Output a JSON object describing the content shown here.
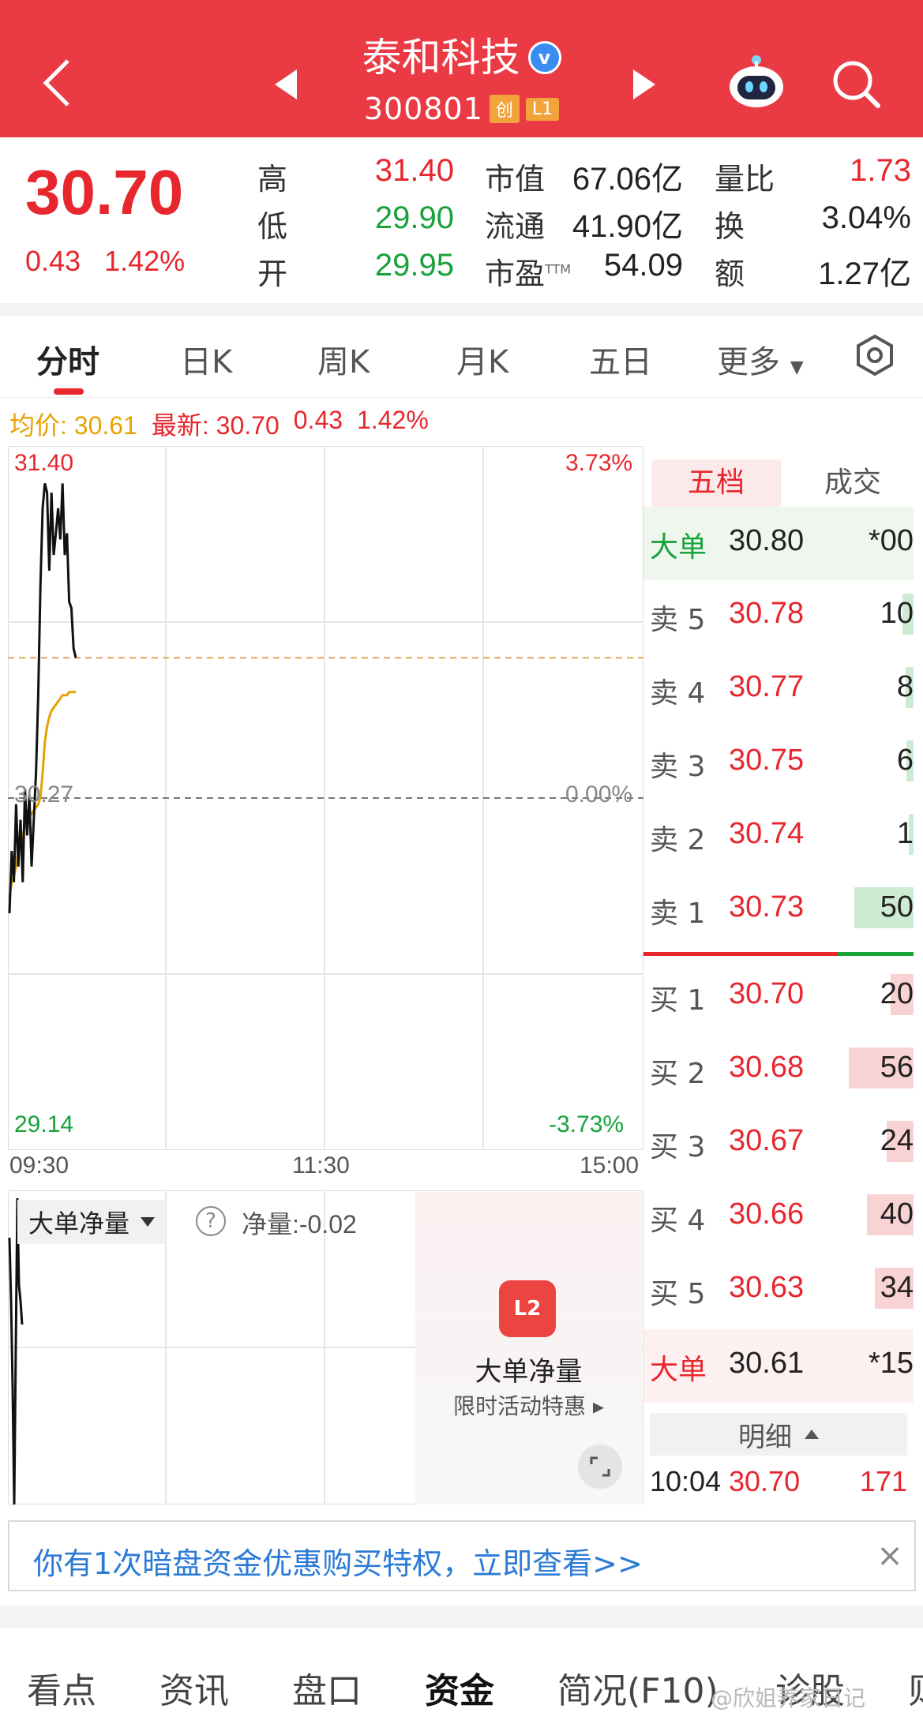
{
  "header": {
    "title": "泰和科技",
    "code": "300801",
    "tag_board": "创",
    "tag_level": "L1",
    "bg_color": "#ea3a44"
  },
  "quote": {
    "price": "30.70",
    "change": "0.43",
    "change_pct": "1.42%",
    "high_label": "高",
    "high": "31.40",
    "low_label": "低",
    "low": "29.90",
    "open_label": "开",
    "open": "29.95",
    "mcap_label": "市值",
    "mcap": "67.06亿",
    "float_label": "流通",
    "float": "41.90亿",
    "pe_label": "市盈",
    "pe_sup": "TTM",
    "pe": "54.09",
    "vol_ratio_label": "量比",
    "vol_ratio": "1.73",
    "turnover_label": "换",
    "turnover": "3.04%",
    "amount_label": "额",
    "amount": "1.27亿"
  },
  "tabs": [
    "分时",
    "日K",
    "周K",
    "月K",
    "五日",
    "更多"
  ],
  "info_line": {
    "avg": "均价: 30.61",
    "latest": "最新: 30.70",
    "change": "0.43",
    "change_pct": "1.42%"
  },
  "chart_data": {
    "type": "line",
    "y_top": "31.40",
    "y_bottom": "29.14",
    "y_mid": "30.27",
    "pct_top": "3.73%",
    "pct_mid": "0.00%",
    "pct_bottom": "-3.73%",
    "ylim": [
      29.14,
      31.4
    ],
    "x_ticks": [
      "09:30",
      "11:30",
      "15:00"
    ],
    "series": [
      {
        "name": "最新",
        "values": [
          29.9,
          30.1,
          30.0,
          30.25,
          30.05,
          30.2,
          30.0,
          30.3,
          30.15,
          30.28,
          30.05,
          30.2,
          30.35,
          30.6,
          30.95,
          31.2,
          31.28,
          31.25,
          31.0,
          31.25,
          31.05,
          31.12,
          31.2,
          31.1,
          31.28,
          31.05,
          31.12,
          30.9,
          30.88,
          30.75,
          30.72
        ]
      },
      {
        "name": "均价",
        "values": [
          29.95,
          30.0,
          30.02,
          30.05,
          30.1,
          30.12,
          30.15,
          30.18,
          30.2,
          30.21,
          30.22,
          30.23,
          30.24,
          30.25,
          30.27,
          30.35,
          30.45,
          30.5,
          30.53,
          30.55,
          30.56,
          30.57,
          30.58,
          30.59,
          30.6,
          30.6,
          30.6,
          30.61,
          30.61,
          30.61,
          30.61
        ]
      }
    ],
    "colors": {
      "price": "#111111",
      "avg": "#e6a300",
      "up": "#e8262d",
      "down": "#17a23a"
    }
  },
  "sub_chart": {
    "indicator": "大单净量",
    "net_label": "净量:-0.02"
  },
  "promo": {
    "icon_text": "L2",
    "title": "大单净量",
    "subtitle": "限时活动特惠 ▸"
  },
  "order_book": {
    "tab_active": "五档",
    "tab_other": "成交",
    "big_ask": {
      "label": "大单",
      "price": "30.80",
      "vol": "*00"
    },
    "asks": [
      {
        "label": "卖 5",
        "price": "30.78",
        "vol": "10",
        "bar": 0.08
      },
      {
        "label": "卖 4",
        "price": "30.77",
        "vol": "8",
        "bar": 0.06
      },
      {
        "label": "卖 3",
        "price": "30.75",
        "vol": "6",
        "bar": 0.05
      },
      {
        "label": "卖 2",
        "price": "30.74",
        "vol": "1",
        "bar": 0.02
      },
      {
        "label": "卖 1",
        "price": "30.73",
        "vol": "50",
        "bar": 0.44
      }
    ],
    "bids": [
      {
        "label": "买 1",
        "price": "30.70",
        "vol": "20",
        "bar": 0.17
      },
      {
        "label": "买 2",
        "price": "30.68",
        "vol": "56",
        "bar": 0.48
      },
      {
        "label": "买 3",
        "price": "30.67",
        "vol": "24",
        "bar": 0.2
      },
      {
        "label": "买 4",
        "price": "30.66",
        "vol": "40",
        "bar": 0.35
      },
      {
        "label": "买 5",
        "price": "30.63",
        "vol": "34",
        "bar": 0.29
      }
    ],
    "big_bid": {
      "label": "大单",
      "price": "30.61",
      "vol": "*15"
    },
    "detail_label": "明细",
    "detail": {
      "time": "10:04",
      "price": "30.70",
      "vol": "171"
    },
    "divider_red_pct": 0.72
  },
  "banner": {
    "text": "你有1次暗盘资金优惠购买特权，立即查看>>",
    "close": "×"
  },
  "bottom_tabs": [
    "看点",
    "资讯",
    "盘口",
    "资金",
    "简况(F10)",
    "诊股",
    "则"
  ],
  "bottom_tab_active": "资金",
  "watermark": "@欣姐养家日记"
}
